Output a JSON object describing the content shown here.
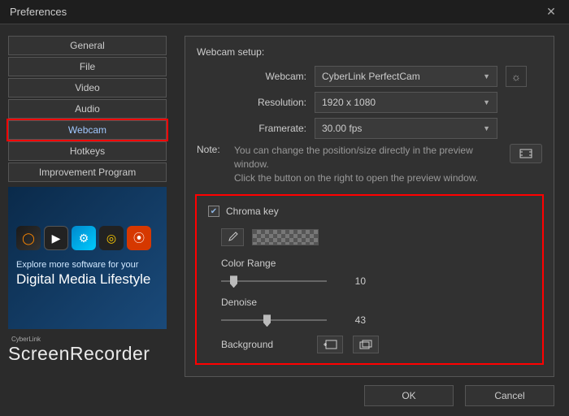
{
  "window": {
    "title": "Preferences"
  },
  "sidebar": {
    "items": [
      {
        "label": "General"
      },
      {
        "label": "File"
      },
      {
        "label": "Video"
      },
      {
        "label": "Audio"
      },
      {
        "label": "Webcam"
      },
      {
        "label": "Hotkeys"
      },
      {
        "label": "Improvement Program"
      }
    ],
    "active_index": 4
  },
  "promo": {
    "line1": "Explore more software for your",
    "line2": "Digital Media Lifestyle"
  },
  "brand": {
    "small": "CyberLink",
    "main": "ScreenRecorder"
  },
  "webcam": {
    "section_title": "Webcam setup:",
    "labels": {
      "webcam": "Webcam:",
      "resolution": "Resolution:",
      "framerate": "Framerate:"
    },
    "values": {
      "webcam": "CyberLink PerfectCam",
      "resolution": "1920 x 1080",
      "framerate": "30.00 fps"
    },
    "note_label": "Note:",
    "note_text1": "You can change the position/size directly in the preview window.",
    "note_text2": "Click the button on the right to open the preview window."
  },
  "chroma": {
    "checkbox_label": "Chroma key",
    "checked": true,
    "color_range_label": "Color Range",
    "color_range_value": 10,
    "denoise_label": "Denoise",
    "denoise_value": 43,
    "background_label": "Background"
  },
  "buttons": {
    "ok": "OK",
    "cancel": "Cancel"
  }
}
